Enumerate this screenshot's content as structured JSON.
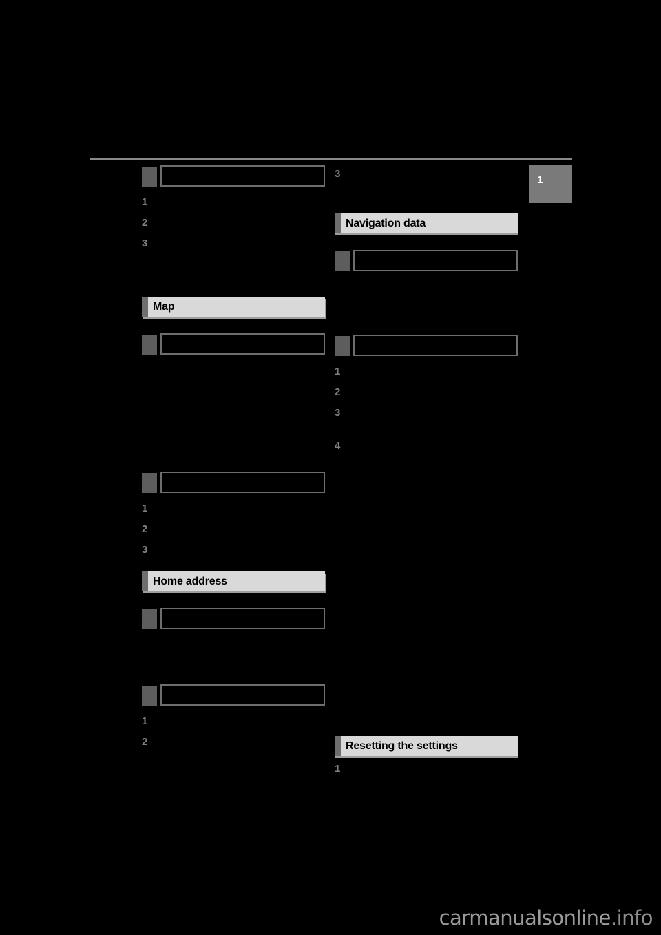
{
  "page": {
    "background_color": "#000000",
    "rule_color": "#8a8a8a",
    "section_header_bg": "#d9d9d9",
    "section_header_tab": "#6e6e6e",
    "sub_header_tab": "#5d5d5d",
    "sub_header_border": "#6e6e6e",
    "step_marker_color": "#808080",
    "chapter_tab_bg": "#7a7a7a"
  },
  "chapter_tab": {
    "number": "1"
  },
  "left_column": {
    "sub_header_1": {
      "label": ""
    },
    "steps_a": [
      {
        "marker": "1",
        "text": ""
      },
      {
        "marker": "2",
        "text": ""
      },
      {
        "marker": "3",
        "text": ""
      }
    ],
    "section_map": {
      "title": "Map"
    },
    "sub_header_2": {
      "label": ""
    },
    "sub_header_3": {
      "label": ""
    },
    "steps_b": [
      {
        "marker": "1",
        "text": ""
      },
      {
        "marker": "2",
        "text": ""
      },
      {
        "marker": "3",
        "text": ""
      }
    ],
    "section_home_address": {
      "title": "Home address"
    },
    "sub_header_4": {
      "label": ""
    },
    "sub_header_5": {
      "label": ""
    },
    "steps_c": [
      {
        "marker": "1",
        "text": ""
      },
      {
        "marker": "2",
        "text": ""
      }
    ]
  },
  "right_column": {
    "step_top": {
      "marker": "3",
      "text": ""
    },
    "section_navigation_data": {
      "title": "Navigation data"
    },
    "sub_header_1": {
      "label": ""
    },
    "sub_header_2": {
      "label": ""
    },
    "steps_a": [
      {
        "marker": "1",
        "text": ""
      },
      {
        "marker": "2",
        "text": ""
      },
      {
        "marker": "3",
        "text": ""
      },
      {
        "marker": "4",
        "text": ""
      }
    ],
    "section_resetting": {
      "title": "Resetting the settings"
    },
    "steps_b": [
      {
        "marker": "1",
        "text": ""
      }
    ]
  },
  "watermark": {
    "name": "carmanualsonline",
    "tld": ".info"
  }
}
